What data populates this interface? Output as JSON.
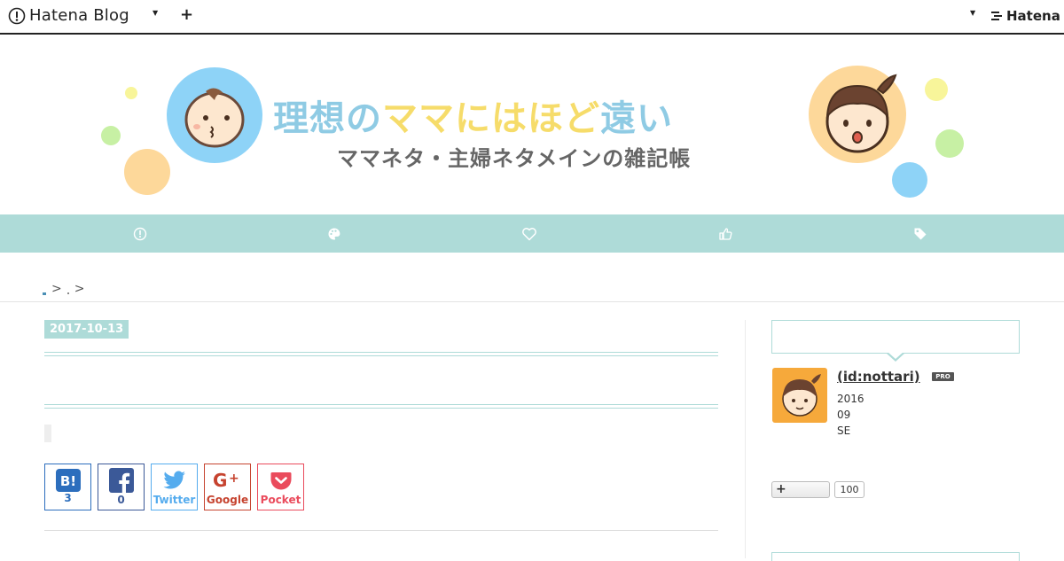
{
  "topbar": {
    "logo_text": "Hatena Blog",
    "add_label": "+",
    "brand_text": "Hatena",
    "icons": [
      "hatena-blog-logo-icon",
      "caret-down-icon",
      "plus-icon",
      "caret-down-icon",
      "hatena-logo-icon"
    ]
  },
  "banner": {
    "title_part1": "理想の",
    "title_part2": "ママにはほど",
    "title_part3": "遠い",
    "subtitle": "ママネタ・主婦ネタメインの雑記帳",
    "colors": {
      "blue": "#8ed3f7",
      "yellow": "#f8f59a",
      "orange": "#fdd89a",
      "green": "#c7f0a4"
    }
  },
  "navbar": {
    "background": "#aedbd8",
    "items": [
      "hatena-blog-icon",
      "palette-icon",
      "heart-icon",
      "thumbs-up-icon",
      "tag-icon"
    ]
  },
  "breadcrumb": {
    "sep1": ">",
    "sep2": ">"
  },
  "article": {
    "date": "2017-10-13",
    "share": [
      {
        "name": "hatena-bookmark",
        "icon": "hatena-bookmark-icon",
        "label": "3"
      },
      {
        "name": "facebook",
        "icon": "facebook-icon",
        "label": "0"
      },
      {
        "name": "twitter",
        "icon": "twitter-icon",
        "label": "Twitter"
      },
      {
        "name": "google",
        "icon": "google-plus-icon",
        "label": "Google"
      },
      {
        "name": "pocket",
        "icon": "pocket-icon",
        "label": "Pocket"
      }
    ]
  },
  "sidebar": {
    "profile": {
      "id_text": " (id:nottari)",
      "badge": "PRO",
      "lines": [
        "2016",
        "09",
        "SE"
      ]
    },
    "follow": {
      "label": "+",
      "count": "100"
    }
  }
}
